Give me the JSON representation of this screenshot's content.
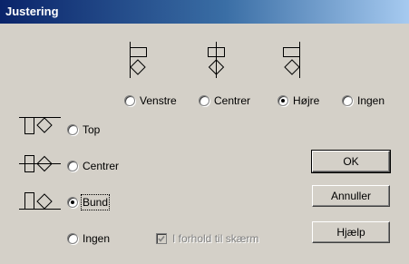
{
  "window": {
    "title": "Justering"
  },
  "horizontal": {
    "options": [
      {
        "label": "Venstre",
        "checked": false
      },
      {
        "label": "Centrer",
        "checked": false
      },
      {
        "label": "Højre",
        "checked": true
      },
      {
        "label": "Ingen",
        "checked": false
      }
    ]
  },
  "vertical": {
    "options": [
      {
        "label": "Top",
        "checked": false
      },
      {
        "label": "Centrer",
        "checked": false
      },
      {
        "label": "Bund",
        "checked": true
      },
      {
        "label": "Ingen",
        "checked": false
      }
    ]
  },
  "relative_checkbox": {
    "label": "I forhold til skærm",
    "checked": true,
    "enabled": false
  },
  "buttons": {
    "ok": "OK",
    "cancel": "Annuller",
    "help": "Hjælp"
  },
  "icons": {
    "h_left": "align-left-icon",
    "h_center": "align-center-icon",
    "h_right": "align-right-icon",
    "v_top": "align-top-icon",
    "v_center": "align-middle-icon",
    "v_bottom": "align-bottom-icon"
  }
}
